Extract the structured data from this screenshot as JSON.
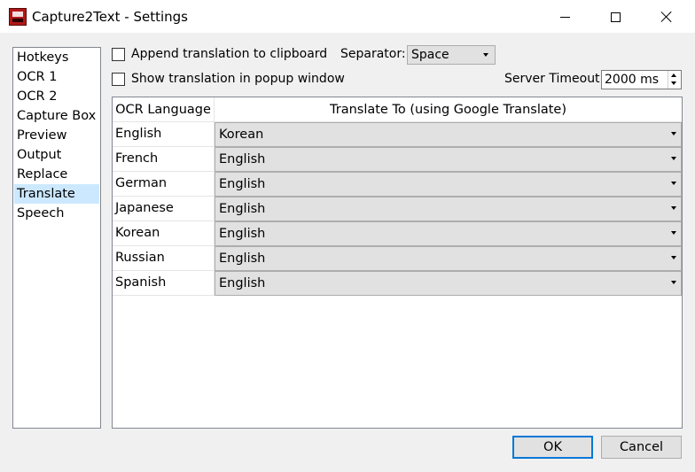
{
  "window": {
    "title": "Capture2Text - Settings"
  },
  "sidebar": {
    "items": [
      {
        "label": "Hotkeys"
      },
      {
        "label": "OCR 1"
      },
      {
        "label": "OCR 2"
      },
      {
        "label": "Capture Box"
      },
      {
        "label": "Preview"
      },
      {
        "label": "Output"
      },
      {
        "label": "Replace"
      },
      {
        "label": "Translate",
        "selected": true
      },
      {
        "label": "Speech"
      }
    ]
  },
  "options": {
    "append_label": "Append translation to clipboard",
    "append_checked": false,
    "popup_label": "Show translation in popup window",
    "popup_checked": false,
    "separator_label": "Separator:",
    "separator_value": "Space",
    "timeout_label": "Server Timeout:",
    "timeout_value": "2000 ms"
  },
  "table": {
    "headers": [
      "OCR Language",
      "Translate To (using Google Translate)"
    ],
    "rows": [
      {
        "ocr": "English",
        "to": "Korean"
      },
      {
        "ocr": "French",
        "to": "English"
      },
      {
        "ocr": "German",
        "to": "English"
      },
      {
        "ocr": "Japanese",
        "to": "English"
      },
      {
        "ocr": "Korean",
        "to": "English"
      },
      {
        "ocr": "Russian",
        "to": "English"
      },
      {
        "ocr": "Spanish",
        "to": "English"
      }
    ]
  },
  "buttons": {
    "ok": "OK",
    "cancel": "Cancel"
  },
  "colors": {
    "selection": "#cce8ff",
    "accent": "#0078d7"
  },
  "icons": {
    "app": "capture2text-app-icon",
    "minimize": "minimize-icon",
    "maximize": "maximize-icon",
    "close": "close-icon"
  }
}
